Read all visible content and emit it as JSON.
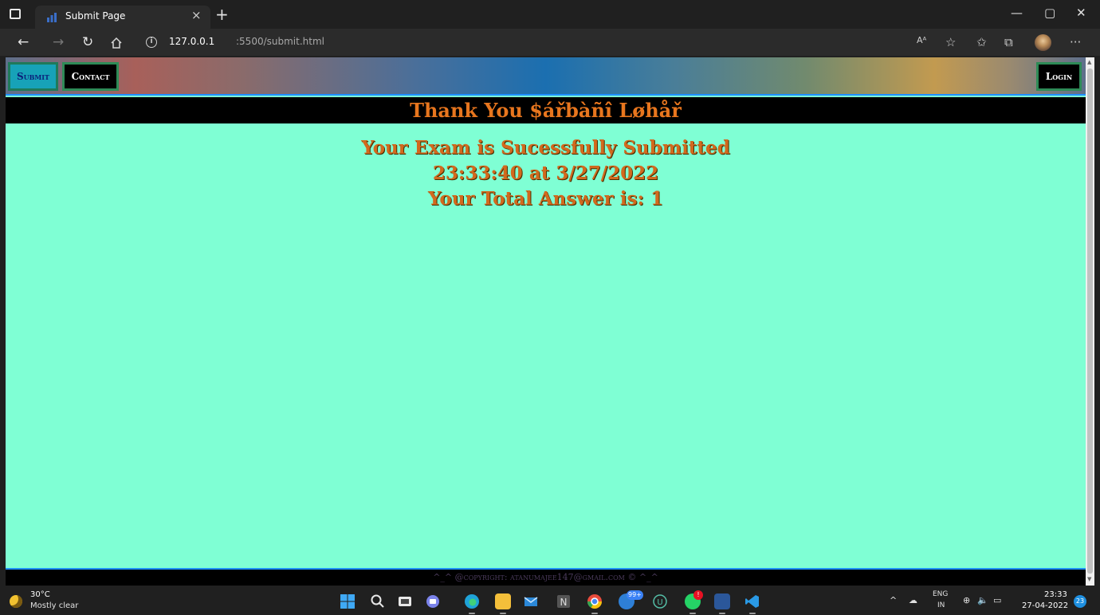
{
  "browser": {
    "tab_title": "Submit Page",
    "tab_close": "×",
    "new_tab": "+",
    "minimize": "—",
    "maximize": "▢",
    "close": "✕",
    "url_host": "127.0.0.1",
    "url_path": ":5500/submit.html",
    "read_aloud": "Aᴬ",
    "more": "···"
  },
  "page": {
    "nav": {
      "submit": "Submit",
      "contact": "Contact",
      "login": "Login"
    },
    "heading": "Thank You $ářbàñî Løhåř",
    "message_line1": "Your Exam is Sucessfully Submitted",
    "message_line2": "23:33:40 at 3/27/2022",
    "message_line3": "Your Total Answer is: 1",
    "footer": "^_^ @copyright: atanumajee147@gmail.com © ^_^"
  },
  "taskbar": {
    "weather_temp": "30°C",
    "weather_desc": "Mostly clear",
    "notification_badge": "99+",
    "lang_top": "ENG",
    "lang_bottom": "IN",
    "time": "23:33",
    "date": "27-04-2022",
    "notification_count": "23"
  },
  "colors": {
    "page_background": "#7fffd4",
    "heading_text": "#e8761e",
    "message_text": "#d2691e"
  }
}
